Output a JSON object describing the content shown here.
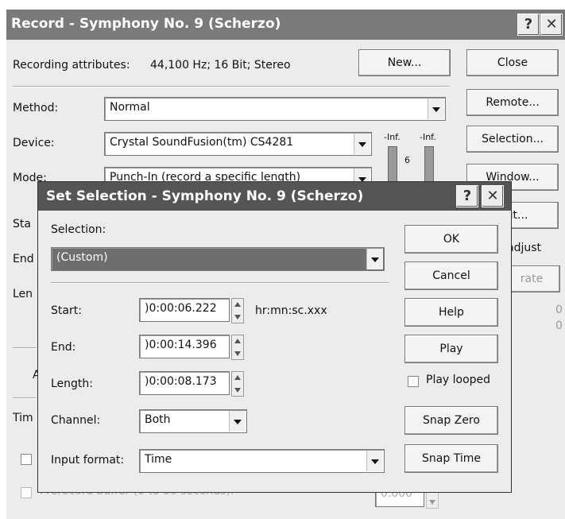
{
  "record": {
    "title": "Record - Symphony No. 9 (Scherzo)",
    "help_glyph": "?",
    "close_glyph": "✕",
    "attributes_label": "Recording attributes:",
    "attributes_value": "44,100 Hz; 16 Bit; Stereo",
    "new_label": "New...",
    "close_label": "Close",
    "method_label": "Method:",
    "method_value": "Normal",
    "remote_label": "Remote...",
    "device_label": "Device:",
    "device_value": "Crystal SoundFusion(tm) CS4281",
    "meter_left_label": "-Inf.",
    "meter_right_label": "-Inf.",
    "meter_tick": "6",
    "selection_label": "Selection...",
    "mode_label": "Mode:",
    "mode_value": "Punch-In (record a specific length)",
    "window_label": "Window...",
    "start_partial": "Sta",
    "end_partial": "End",
    "length_partial": "Len",
    "out_label": "Out...",
    "adjust_label": "adjust",
    "rate_label": "rate",
    "zero1": "0",
    "zero2": "0",
    "a_partial": "A",
    "time_partial": "Tim",
    "prerecord_label": "Prerecord buffer (0 to 30 seconds):",
    "prerecord_value": "0.000"
  },
  "dialog": {
    "title": "Set Selection - Symphony No. 9 (Scherzo)",
    "help_glyph": "?",
    "close_glyph": "✕",
    "selection_label": "Selection:",
    "selection_value": "(Custom)",
    "ok_label": "OK",
    "cancel_label": "Cancel",
    "start_label": "Start:",
    "start_value": ")0:00:06.222",
    "time_format_hint": "hr:mn:sc.xxx",
    "help_label": "Help",
    "end_label": "End:",
    "end_value": ")0:00:14.396",
    "play_label": "Play",
    "length_label": "Length:",
    "length_value": ")0:00:08.173",
    "play_looped_label": "Play looped",
    "channel_label": "Channel:",
    "channel_value": "Both",
    "snap_zero_label": "Snap Zero",
    "input_format_label": "Input format:",
    "input_format_value": "Time",
    "snap_time_label": "Snap Time"
  },
  "colors": {
    "titlebar": "#7a7a7a",
    "dialog_titlebar": "#555555",
    "window_bg": "#ececec",
    "selected_bg": "#6e6e6e"
  }
}
